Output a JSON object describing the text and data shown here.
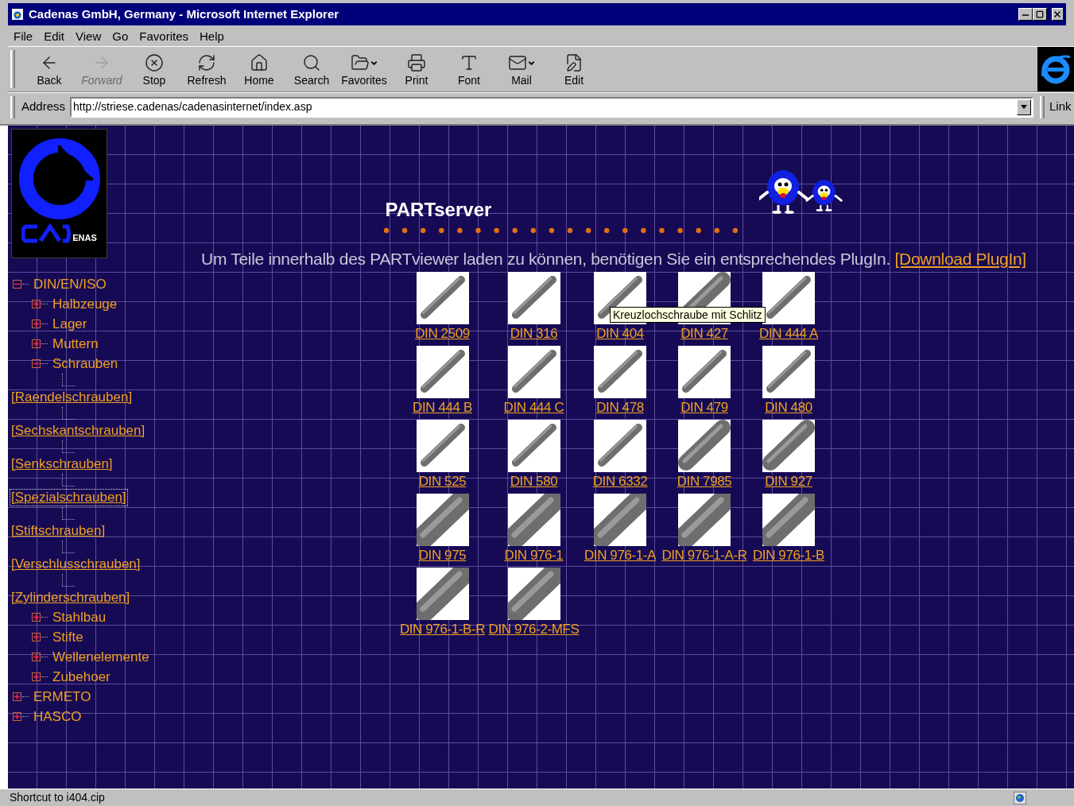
{
  "window": {
    "title": "Cadenas GmbH, Germany - Microsoft Internet Explorer"
  },
  "menu": [
    "File",
    "Edit",
    "View",
    "Go",
    "Favorites",
    "Help"
  ],
  "toolbar": [
    {
      "label": "Back",
      "disabled": false,
      "dropdown": false
    },
    {
      "label": "Forward",
      "disabled": true,
      "dropdown": false
    },
    {
      "label": "Stop",
      "disabled": false,
      "dropdown": false
    },
    {
      "label": "Refresh",
      "disabled": false,
      "dropdown": false
    },
    {
      "label": "Home",
      "disabled": false,
      "dropdown": false
    },
    {
      "label": "Search",
      "disabled": false,
      "dropdown": false
    },
    {
      "label": "Favorites",
      "disabled": false,
      "dropdown": true
    },
    {
      "label": "Print",
      "disabled": false,
      "dropdown": false
    },
    {
      "label": "Font",
      "disabled": false,
      "dropdown": false
    },
    {
      "label": "Mail",
      "disabled": false,
      "dropdown": true
    },
    {
      "label": "Edit",
      "disabled": false,
      "dropdown": false
    }
  ],
  "address_bar": {
    "label": "Address",
    "value": "http://striese.cadenas/cadenasinternet/index.asp",
    "links_label": "Link"
  },
  "logo": {
    "text": "ENAS"
  },
  "tree": [
    {
      "kind": "folder",
      "label": "DIN/EN/ISO",
      "expanded": true,
      "children": [
        {
          "kind": "folder",
          "label": "Halbzeuge",
          "expanded": false
        },
        {
          "kind": "folder",
          "label": "Lager",
          "expanded": false
        },
        {
          "kind": "folder",
          "label": "Muttern",
          "expanded": false
        },
        {
          "kind": "folder",
          "label": "Schrauben",
          "expanded": true,
          "children": [
            {
              "kind": "link",
              "label": "[Raendelschrauben]",
              "focused": false
            },
            {
              "kind": "link",
              "label": "[Sechskantschrauben]",
              "focused": false
            },
            {
              "kind": "link",
              "label": "[Senkschrauben]",
              "focused": false
            },
            {
              "kind": "link",
              "label": "[Spezialschrauben]",
              "focused": true
            },
            {
              "kind": "link",
              "label": "[Stiftschrauben]",
              "focused": false
            },
            {
              "kind": "link",
              "label": "[Verschlusschrauben]",
              "focused": false
            },
            {
              "kind": "link",
              "label": "[Zylinderschrauben]",
              "focused": false
            }
          ]
        },
        {
          "kind": "folder",
          "label": "Stahlbau",
          "expanded": false
        },
        {
          "kind": "folder",
          "label": "Stifte",
          "expanded": false
        },
        {
          "kind": "folder",
          "label": "Wellenelemente",
          "expanded": false
        },
        {
          "kind": "folder",
          "label": "Zubehoer",
          "expanded": false
        }
      ]
    },
    {
      "kind": "folder",
      "label": "ERMETO",
      "expanded": false
    },
    {
      "kind": "folder",
      "label": "HASCO",
      "expanded": false
    }
  ],
  "header": {
    "title": "PARTserver"
  },
  "notice": {
    "text": "Um Teile innerhalb des PARTviewer laden zu können, benötigen Sie ein entsprechendes PlugIn.",
    "link": "[Download PlugIn]"
  },
  "parts": [
    "DIN 2509",
    "DIN 316",
    "DIN 404",
    "DIN 427",
    "DIN 444 A",
    "DIN 444 B",
    "DIN 444 C",
    "DIN 478",
    "DIN 479",
    "DIN 480",
    "DIN 525",
    "DIN 580",
    "DIN 6332",
    "DIN 7985",
    "DIN 927",
    "DIN 975",
    "DIN 976-1",
    "DIN 976-1-A",
    "DIN 976-1-A-R",
    "DIN 976-1-B",
    "DIN 976-1-B-R",
    "DIN 976-2-MFS"
  ],
  "tooltip": "Kreuzlochschraube mit Schlitz",
  "status_bar": {
    "text": "Shortcut to i404.cip"
  }
}
